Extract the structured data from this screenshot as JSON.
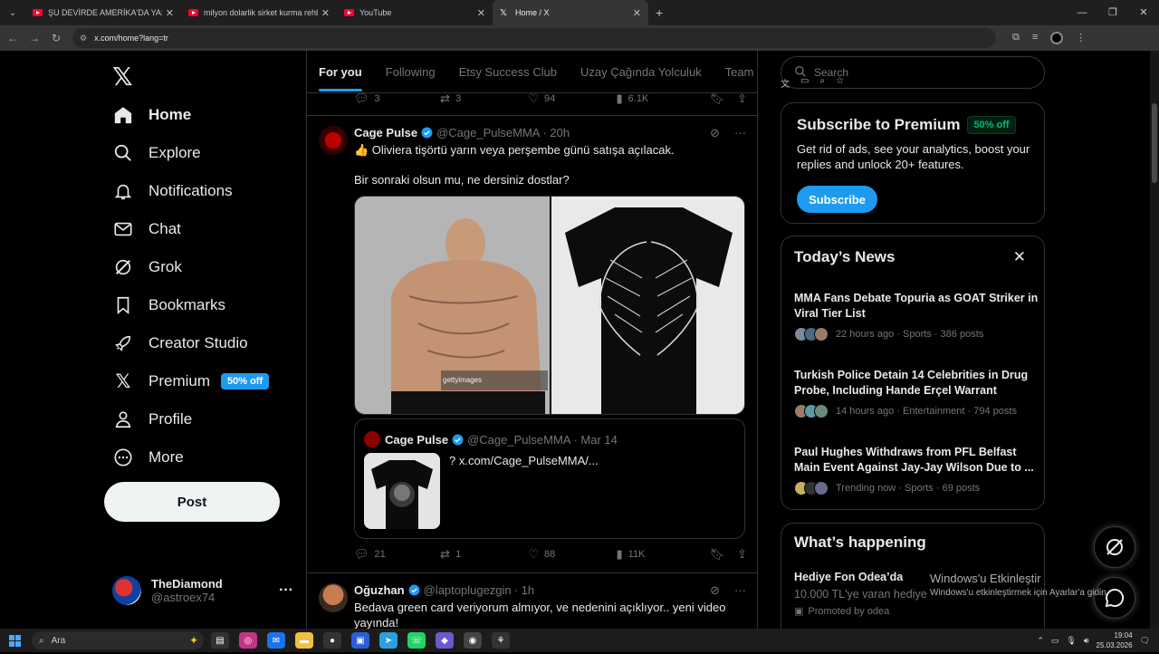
{
  "browser": {
    "tabs": [
      {
        "title": "ŞU DEVİRDE AMERİKA'DA YAŞAMAK",
        "icon": "youtube-icon"
      },
      {
        "title": "milyon dolarlik sirket kurma rehberi",
        "icon": "youtube-icon"
      },
      {
        "title": "YouTube",
        "icon": "youtube-icon"
      },
      {
        "title": "Home / X",
        "icon": "x-icon",
        "active": true
      }
    ],
    "url": "x.com/home?lang=tr"
  },
  "nav": {
    "items": [
      {
        "label": "Home",
        "icon": "home-icon"
      },
      {
        "label": "Explore",
        "icon": "search-icon"
      },
      {
        "label": "Notifications",
        "icon": "bell-icon"
      },
      {
        "label": "Chat",
        "icon": "mail-icon"
      },
      {
        "label": "Grok",
        "icon": "grok-icon"
      },
      {
        "label": "Bookmarks",
        "icon": "bookmark-icon"
      },
      {
        "label": "Creator Studio",
        "icon": "rocket-icon"
      },
      {
        "label": "Premium",
        "icon": "x-logo-icon",
        "badge": "50% off"
      },
      {
        "label": "Profile",
        "icon": "person-icon"
      },
      {
        "label": "More",
        "icon": "more-circle-icon"
      }
    ],
    "post_label": "Post",
    "account": {
      "name": "TheDiamond",
      "handle": "@astroex74"
    }
  },
  "feed": {
    "tabs": [
      "For you",
      "Following",
      "Etsy Success Club",
      "Uzay Çağında Yolculuk",
      "Team M"
    ],
    "prev_actions": {
      "replies": "3",
      "reposts": "3",
      "likes": "94",
      "views": "6.1K"
    },
    "tweet1": {
      "name": "Cage Pulse",
      "handle": "@Cage_PulseMMA",
      "time": "· 20h",
      "line1": "👍 Oliviera tişörtü yarın veya perşembe günü satışa açılacak.",
      "line2": "Bir sonraki olsun mu, ne dersiniz dostlar?",
      "image_watermark": "gettyimages",
      "quote": {
        "name": "Cage Pulse",
        "handle": "@Cage_PulseMMA",
        "time": "· Mar 14",
        "text": "? x.com/Cage_PulseMMA/..."
      },
      "actions": {
        "replies": "21",
        "reposts": "1",
        "likes": "88",
        "views": "11K"
      }
    },
    "tweet2": {
      "name": "Oğuzhan",
      "handle": "@laptoplugezgin",
      "time": "· 1h",
      "text": "Bedava green card veriyorum almıyor, ve nedenini açıklıyor.. yeni video yayında!"
    }
  },
  "sidebar": {
    "search_placeholder": "Search",
    "premium": {
      "title": "Subscribe to Premium",
      "badge": "50% off",
      "text": "Get rid of ads, see your analytics, boost your replies and unlock 20+ features.",
      "button": "Subscribe"
    },
    "news": {
      "title": "Today’s News",
      "items": [
        {
          "title": "MMA Fans Debate Topuria as GOAT Striker in Viral Tier List",
          "meta": "22 hours ago · Sports · 386 posts"
        },
        {
          "title": "Turkish Police Detain 14 Celebrities in Drug Probe, Including Hande Erçel Warrant",
          "meta": "14 hours ago · Entertainment · 794 posts"
        },
        {
          "title": "Paul Hughes Withdraws from PFL Belfast Main Event Against Jay-Jay Wilson Due to ...",
          "meta": "Trending now · Sports · 69 posts"
        }
      ]
    },
    "happening": {
      "title": "What’s happening",
      "item_title": "Hediye Fon Odea’da",
      "item_text": "10.000 TL'ye varan hediye",
      "promoted": "Promoted by odea"
    }
  },
  "windows": {
    "watermark_title": "Windows'u Etkinleştir",
    "watermark_text": "Windows'u etkinleştirmek için Ayarlar'a gidin.",
    "search_label": "Ara",
    "time": "19:04",
    "date": "25.03.2026"
  },
  "colors": {
    "accent": "#1d9bf0",
    "background": "#000000",
    "border": "#2f3336",
    "muted": "#71767b",
    "green": "#00ba7c"
  }
}
